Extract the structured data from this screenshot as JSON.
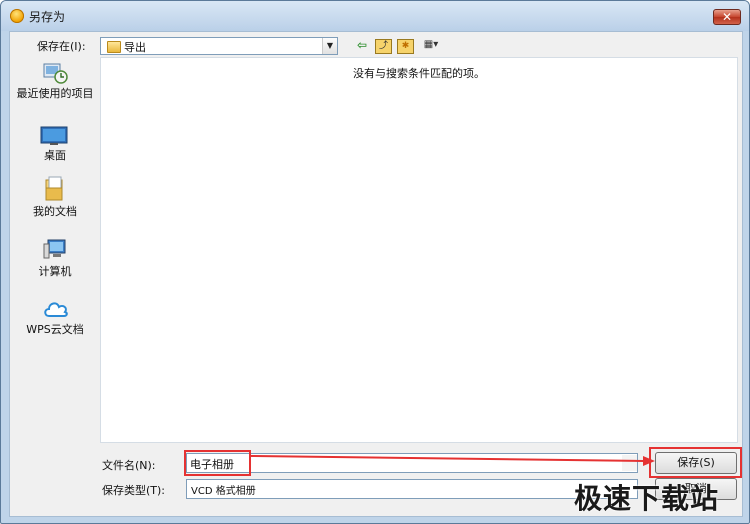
{
  "dialog": {
    "title": "另存为",
    "close_glyph": "✕"
  },
  "location": {
    "label": "保存在(I):",
    "folder": "导出"
  },
  "toolbar": {
    "back_glyph": "⇦",
    "up_glyph": "⤴",
    "new_folder_glyph": "✱",
    "view_glyph": "▦▾"
  },
  "places": [
    {
      "label": "最近使用的项目",
      "icon": "recent-icon"
    },
    {
      "label": "桌面",
      "icon": "desktop-icon"
    },
    {
      "label": "我的文档",
      "icon": "documents-icon"
    },
    {
      "label": "计算机",
      "icon": "computer-icon"
    },
    {
      "label": "WPS云文档",
      "icon": "cloud-icon"
    }
  ],
  "file_list": {
    "empty_message": "没有与搜索条件匹配的项。"
  },
  "file_name": {
    "label": "文件名(N):",
    "value": "电子相册"
  },
  "file_type": {
    "label": "保存类型(T):",
    "value": "VCD 格式相册"
  },
  "buttons": {
    "save": "保存(S)",
    "cancel": "取消"
  },
  "watermark": "极速下载站",
  "colors": {
    "highlight": "#e53232",
    "title_bar": "#bad0e8"
  }
}
